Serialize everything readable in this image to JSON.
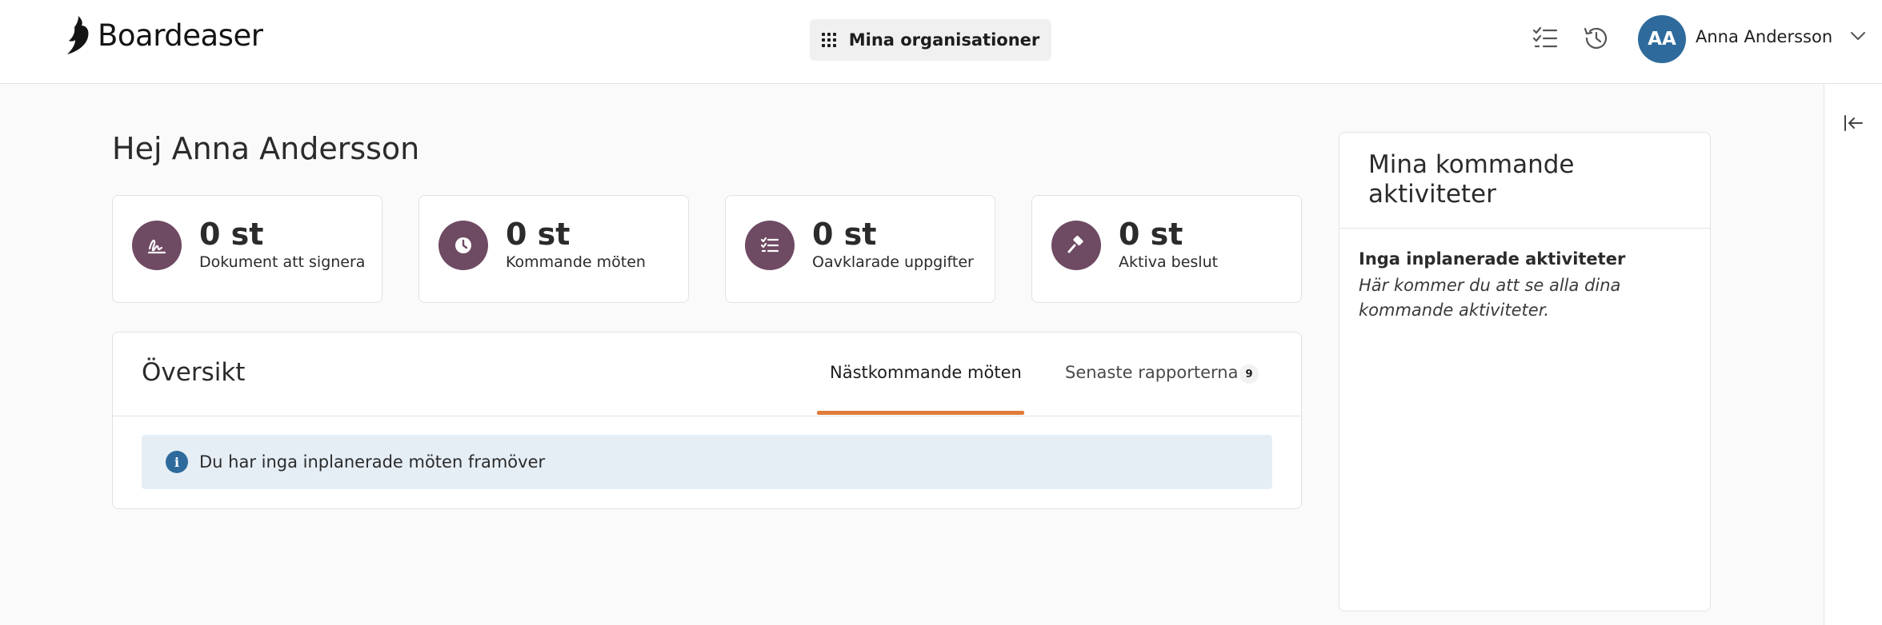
{
  "header": {
    "logo_text": "Boardeaser",
    "org_button_label": "Mina organisationer",
    "user_initials": "AA",
    "user_name": "Anna Andersson",
    "icons": [
      "checklist-icon",
      "history-icon",
      "chevron-down-icon"
    ]
  },
  "greeting": "Hej Anna Andersson",
  "stats": [
    {
      "value": "0 st",
      "label": "Dokument att signera",
      "icon": "signature-icon"
    },
    {
      "value": "0 st",
      "label": "Kommande möten",
      "icon": "clock-icon"
    },
    {
      "value": "0 st",
      "label": "Oavklarade uppgifter",
      "icon": "task-list-icon"
    },
    {
      "value": "0 st",
      "label": "Aktiva beslut",
      "icon": "gavel-icon"
    }
  ],
  "overview": {
    "title": "Översikt",
    "tabs": [
      {
        "label": "Nästkommande möten",
        "active": true
      },
      {
        "label": "Senaste rapporterna",
        "badge": "9",
        "active": false
      }
    ],
    "info_message": "Du har inga inplanerade möten framöver"
  },
  "activities": {
    "title": "Mina kommande aktiviteter",
    "empty_title": "Inga inplanerade aktiviteter",
    "empty_description": "Här kommer du att se alla dina kommande aktiviteter."
  },
  "colors": {
    "accent_orange": "#e07b39",
    "stat_icon_bg": "#6f4a63",
    "avatar_bg": "#2e6b9c",
    "info_bg": "#e6eef5"
  }
}
